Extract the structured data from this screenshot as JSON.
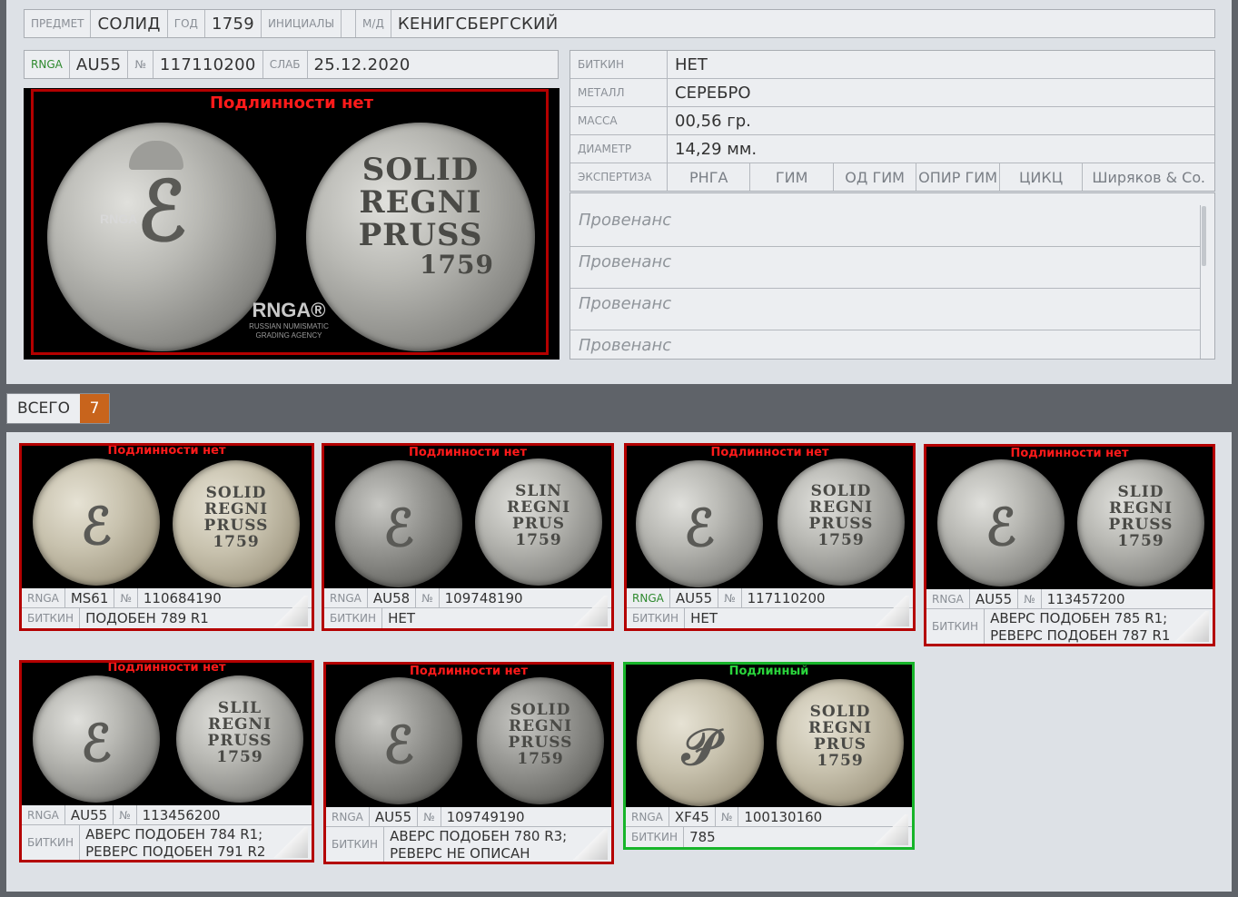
{
  "header": {
    "subject_label": "ПРЕДМЕТ",
    "subject_value": "СОЛИД",
    "year_label": "ГОД",
    "year_value": "1759",
    "initials_label": "ИНИЦИАЛЫ",
    "initials_value": "",
    "mint_label": "М/Д",
    "mint_value": "КЕНИГСБЕРГСКИЙ"
  },
  "grading": {
    "agency_label": "RNGA",
    "grade": "AU55",
    "number_label": "№",
    "number": "117110200",
    "slab_label": "СЛАБ",
    "slab_date": "25.12.2020"
  },
  "main_image": {
    "authenticity": "Подлинности нет",
    "obverse_text": "RNGA",
    "reverse_legend": [
      "SOLID",
      "REGNI",
      "PRUSS",
      "1759"
    ],
    "logo_text": "RNGA®",
    "logo_sub": "RUSSIAN NUMISMATIC GRADING AGENCY"
  },
  "details": {
    "rows": [
      {
        "label": "БИТКИН",
        "value": "НЕТ"
      },
      {
        "label": "МЕТАЛЛ",
        "value": "СЕРЕБРО"
      },
      {
        "label": "МАССА",
        "value": "00,56 гр."
      },
      {
        "label": "ДИАМЕТР",
        "value": "14,29 мм."
      }
    ],
    "expertise_label": "ЭКСПЕРТИЗА",
    "expertise": [
      "РНГА",
      "ГИМ",
      "ОД ГИМ",
      "ОПИР ГИМ",
      "ЦИКЦ",
      "Ширяков & Co."
    ]
  },
  "provenance": [
    "Провенанс",
    "Провенанс",
    "Провенанс",
    "Провенанс"
  ],
  "total": {
    "label": "ВСЕГО",
    "count": "7"
  },
  "colors": {
    "red_frame": "#b40000",
    "green_frame": "#17b52a",
    "badge": "#c8641c"
  },
  "cards": [
    {
      "auth": "Подлинности нет",
      "agency": "RNGA",
      "grade": "MS61",
      "num_label": "№",
      "number": "110684190",
      "bitkin_label": "БИТКИН",
      "bitkin": "ПОДОБЕН 789 R1"
    },
    {
      "auth": "Подлинности нет",
      "agency": "RNGA",
      "grade": "AU58",
      "num_label": "№",
      "number": "109748190",
      "bitkin_label": "БИТКИН",
      "bitkin": "НЕТ"
    },
    {
      "auth": "Подлинности нет",
      "agency": "RNGA",
      "grade": "AU55",
      "num_label": "№",
      "number": "117110200",
      "bitkin_label": "БИТКИН",
      "bitkin": "НЕТ"
    },
    {
      "auth": "Подлинности нет",
      "agency": "RNGA",
      "grade": "AU55",
      "num_label": "№",
      "number": "113457200",
      "bitkin_label": "БИТКИН",
      "bitkin": "АВЕРС ПОДОБЕН 785 R1; РЕВЕРС ПОДОБЕН 787 R1"
    },
    {
      "auth": "Подлинности нет",
      "agency": "RNGA",
      "grade": "AU55",
      "num_label": "№",
      "number": "113456200",
      "bitkin_label": "БИТКИН",
      "bitkin": "АВЕРС ПОДОБЕН 784 R1; РЕВЕРС ПОДОБЕН 791 R2"
    },
    {
      "auth": "Подлинности нет",
      "agency": "RNGA",
      "grade": "AU55",
      "num_label": "№",
      "number": "109749190",
      "bitkin_label": "БИТКИН",
      "bitkin": "АВЕРС ПОДОБЕН 780 R3; РЕВЕРС НЕ ОПИСАН"
    },
    {
      "auth": "Подлинный",
      "agency": "RNGA",
      "grade": "XF45",
      "num_label": "№",
      "number": "100130160",
      "bitkin_label": "БИТКИН",
      "bitkin": "785"
    }
  ]
}
